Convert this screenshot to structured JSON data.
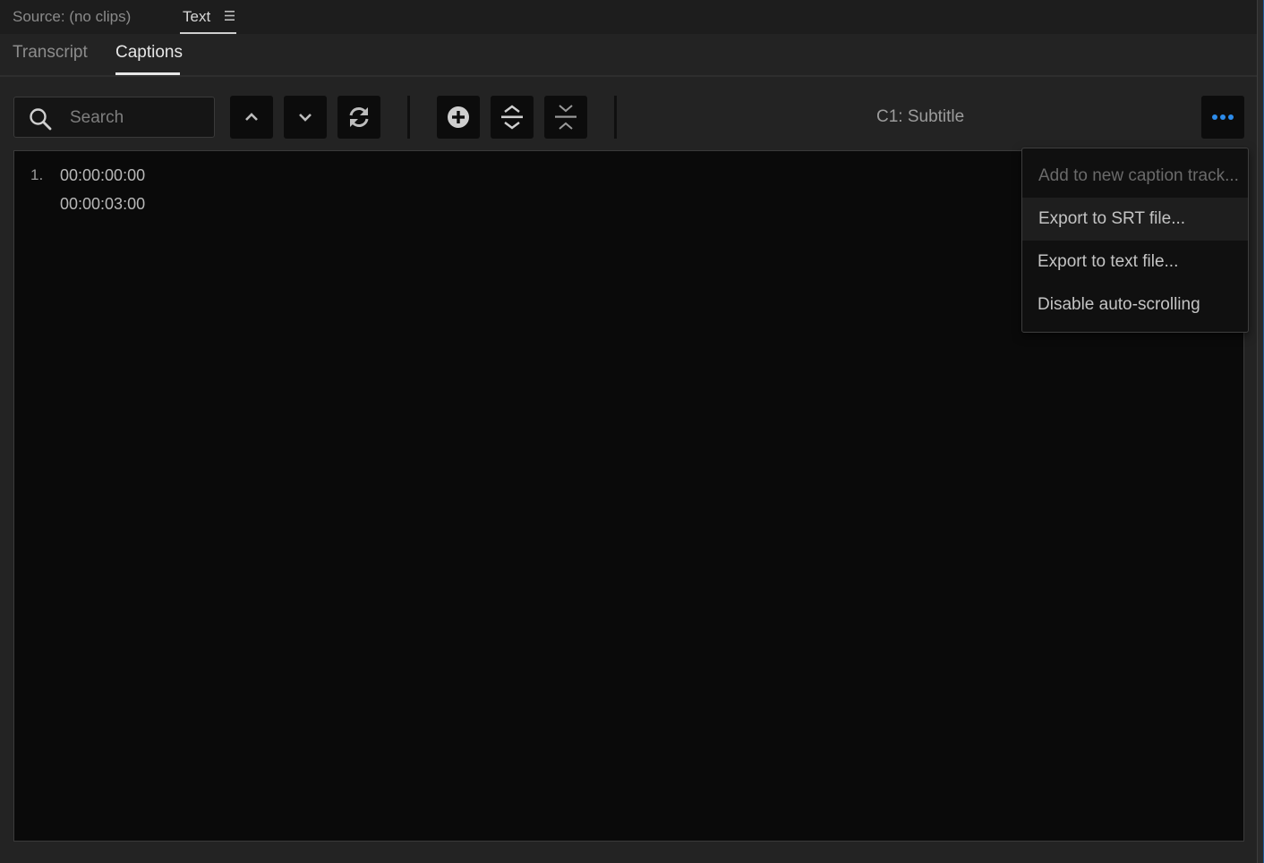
{
  "panel": {
    "source_tab": "Source: (no clips)",
    "text_tab": "Text"
  },
  "subtabs": {
    "transcript": "Transcript",
    "captions": "Captions"
  },
  "search": {
    "placeholder": "Search",
    "value": ""
  },
  "toolbar": {
    "icons": [
      "chevron-up-icon",
      "chevron-down-icon",
      "refresh-icon",
      "add-caption-icon",
      "expand-icon",
      "collapse-icon"
    ],
    "track_label": "C1: Subtitle",
    "more_icon": "ellipsis-icon",
    "accent_color": "#2d8ceb"
  },
  "captions": [
    {
      "index": "1.",
      "in": "00:00:00:00",
      "out": "00:00:03:00"
    }
  ],
  "menu": {
    "items": [
      {
        "label": "Add to new caption track...",
        "enabled": false
      },
      {
        "label": "Export to SRT file...",
        "enabled": true
      },
      {
        "label": "Export to text file...",
        "enabled": true
      },
      {
        "label": "Disable auto-scrolling",
        "enabled": true
      }
    ]
  }
}
